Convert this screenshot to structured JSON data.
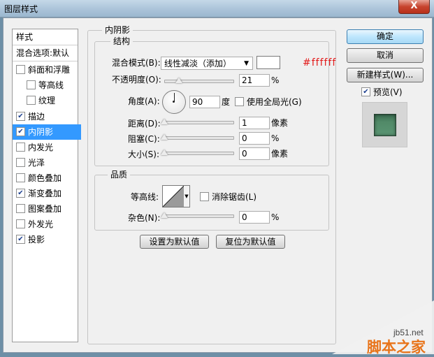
{
  "window": {
    "title": "图层样式",
    "close_glyph": "X"
  },
  "left_panel": {
    "header": "样式",
    "blend_options": "混合选项:默认",
    "items": [
      {
        "label": "斜面和浮雕",
        "checked": false
      },
      {
        "label": "等高线",
        "checked": false
      },
      {
        "label": "纹理",
        "checked": false
      },
      {
        "label": "描边",
        "checked": true
      },
      {
        "label": "内阴影",
        "checked": true,
        "selected": true
      },
      {
        "label": "内发光",
        "checked": false
      },
      {
        "label": "光泽",
        "checked": false
      },
      {
        "label": "颜色叠加",
        "checked": false
      },
      {
        "label": "渐变叠加",
        "checked": true
      },
      {
        "label": "图案叠加",
        "checked": false
      },
      {
        "label": "外发光",
        "checked": false
      },
      {
        "label": "投影",
        "checked": true
      }
    ],
    "check_glyph": "✔"
  },
  "inner_shadow": {
    "section_title": "内阴影",
    "structure_title": "结构",
    "blend_mode_label": "混合模式(B):",
    "blend_mode_value": "线性减淡（添加）",
    "color_hex": "#ffffff",
    "opacity_label": "不透明度(O):",
    "opacity_value": "21",
    "opacity_unit": "%",
    "angle_label": "角度(A):",
    "angle_value": "90",
    "angle_unit": "度",
    "global_light_label": "使用全局光(G)",
    "global_light_checked": false,
    "distance_label": "距离(D):",
    "distance_value": "1",
    "distance_unit": "像素",
    "choke_label": "阻塞(C):",
    "choke_value": "0",
    "choke_unit": "%",
    "size_label": "大小(S):",
    "size_value": "0",
    "size_unit": "像素"
  },
  "quality": {
    "title": "品质",
    "contour_label": "等高线:",
    "anti_alias_label": "消除锯齿(L)",
    "anti_alias_checked": false,
    "noise_label": "杂色(N):",
    "noise_value": "0",
    "noise_unit": "%"
  },
  "buttons": {
    "set_default": "设置为默认值",
    "reset_default": "复位为默认值",
    "ok": "确定",
    "cancel": "取消",
    "new_style": "新建样式(W)...",
    "preview_label": "预览(V)",
    "preview_checked": true
  },
  "watermark": {
    "site": "jb51.net",
    "brand": "脚本之家"
  },
  "colors": {
    "selection": "#3399ff",
    "hex_text": "#e21b1b",
    "preview_green": "#518a68",
    "watermark_orange": "#e8741a"
  }
}
